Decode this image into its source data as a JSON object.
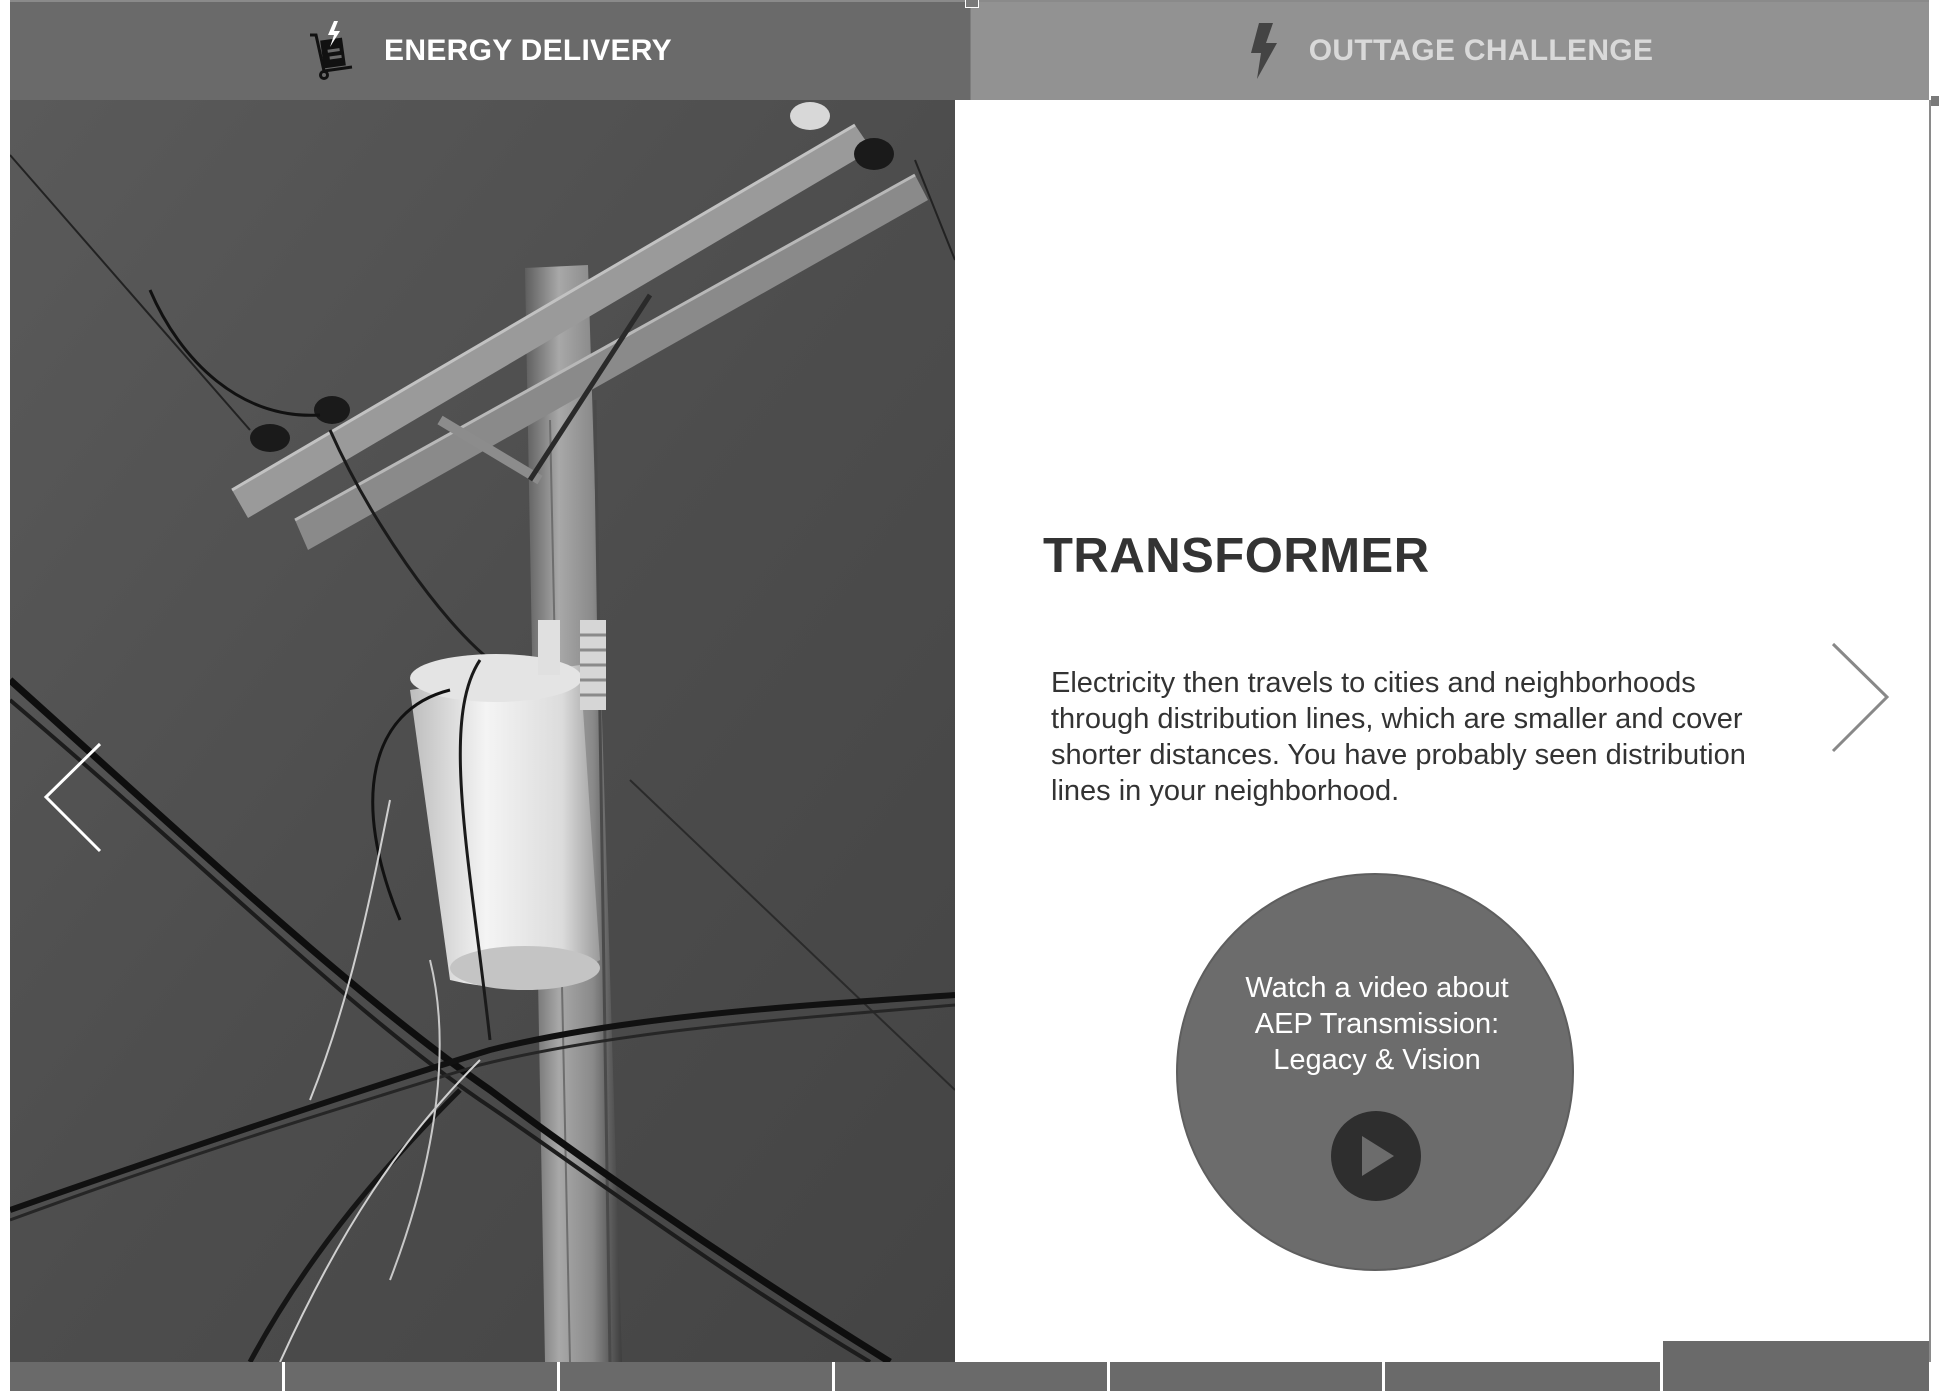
{
  "tabs": [
    {
      "label": "ENERGY DELIVERY",
      "icon": "hand-truck-lightning-icon",
      "active": true
    },
    {
      "label": "OUTTAGE CHALLENGE",
      "icon": "lightning-bolt-icon",
      "active": false
    }
  ],
  "slide": {
    "title": "TRANSFORMER",
    "body": "Electricity then travels to cities and neighborhoods through distribution lines, which are smaller and cover shorter distances. You have probably seen distribution lines in your neighborhood.",
    "video": {
      "label": "Watch a video about\nAEP Transmission:\nLegacy & Vision",
      "play_icon": "play-icon"
    },
    "prev_icon": "chevron-left-icon",
    "next_icon": "chevron-right-icon",
    "image_icon": "utility-pole-transformer-photo"
  },
  "progress": {
    "total_segments": 7,
    "current_segment": 7
  },
  "colors": {
    "tab_active_bg": "#6a6a6a",
    "tab_inactive_bg": "#929292",
    "heading": "#333333",
    "video_circle": "#6c6c6c",
    "play_button": "#2e2e2e"
  }
}
